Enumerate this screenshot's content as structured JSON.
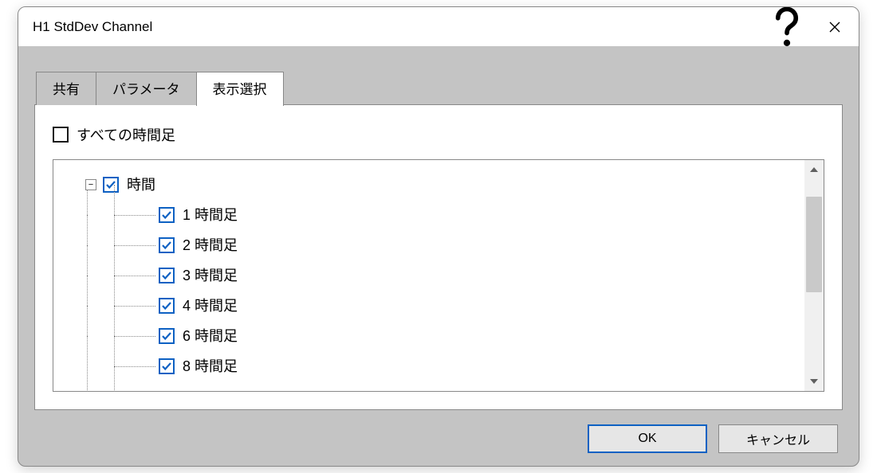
{
  "titlebar": {
    "title": "H1 StdDev Channel"
  },
  "tabs": [
    {
      "label": "共有",
      "active": false
    },
    {
      "label": "パラメータ",
      "active": false
    },
    {
      "label": "表示選択",
      "active": true
    }
  ],
  "all_timeframes": {
    "label": "すべての時間足",
    "checked": false
  },
  "tree": {
    "parent": {
      "label": "時間",
      "checked": true,
      "expanded": true
    },
    "children": [
      {
        "label": "1 時間足",
        "checked": true
      },
      {
        "label": "2 時間足",
        "checked": true
      },
      {
        "label": "3 時間足",
        "checked": true
      },
      {
        "label": "4 時間足",
        "checked": true
      },
      {
        "label": "6 時間足",
        "checked": true
      },
      {
        "label": "8 時間足",
        "checked": true
      }
    ]
  },
  "buttons": {
    "ok": "OK",
    "cancel": "キャンセル"
  }
}
